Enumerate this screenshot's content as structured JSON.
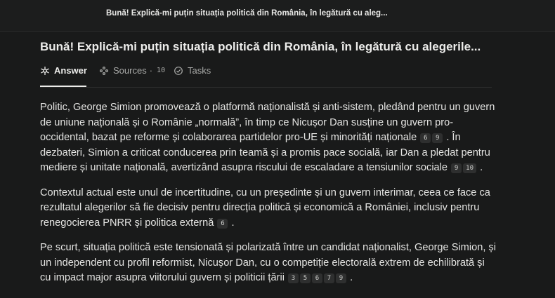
{
  "header": {
    "title": "Bună! Explică-mi puțin situația politică din România, în legătură cu aleg..."
  },
  "thread": {
    "title": "Bună! Explică-mi puțin situația politică din România, în legătură cu alegerile..."
  },
  "tabs": {
    "answer": "Answer",
    "sources": "Sources",
    "sources_sep": "·",
    "sources_count": "10",
    "tasks": "Tasks"
  },
  "content": {
    "p1": {
      "t1": "Politic, George Simion promovează o platformă naționalistă și anti-sistem, pledând pentru un guvern de uniune națională și o Românie „normală”, în timp ce Nicușor Dan susține un guvern pro-occidental, bazat pe reforme și colaborarea partidelor pro-UE și minorități naționale",
      "c1": [
        "6",
        "9"
      ],
      "t2": ". În dezbateri, Simion a criticat conducerea prin teamă și a promis pace socială, iar Dan a pledat pentru mediere și unitate națională, avertizând asupra riscului de escaladare a tensiunilor sociale",
      "c2": [
        "9",
        "10"
      ],
      "t3": "."
    },
    "p2": {
      "t1": "Contextul actual este unul de incertitudine, cu un președinte și un guvern interimar, ceea ce face ca rezultatul alegerilor să fie decisiv pentru direcția politică și economică a României, inclusiv pentru renegocierea PNRR și politica externă",
      "c1": [
        "6"
      ],
      "t2": "."
    },
    "p3": {
      "t1": "Pe scurt, situația politică este tensionată și polarizată între un candidat naționalist, George Simion, și un independent cu profil reformist, Nicușor Dan, cu o competiție electorală extrem de echilibrată și cu impact major asupra viitorului guvern și politicii țării",
      "c1": [
        "3",
        "5",
        "6",
        "7",
        "9"
      ],
      "t2": "."
    }
  }
}
